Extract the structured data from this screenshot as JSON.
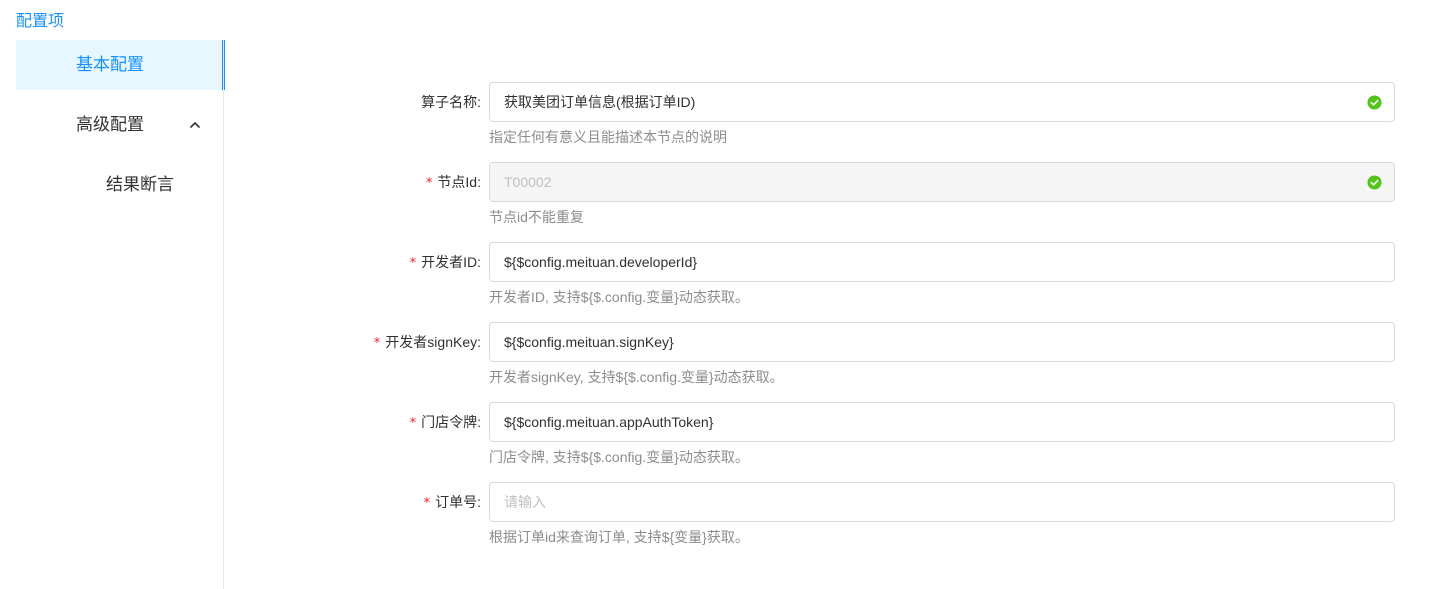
{
  "section_title": "配置项",
  "sidebar": {
    "items": [
      {
        "label": "基本配置"
      },
      {
        "label": "高级配置"
      },
      {
        "label": "结果断言"
      }
    ]
  },
  "form": {
    "rows": [
      {
        "label": "算子名称:",
        "value": "获取美团订单信息(根据订单ID)",
        "placeholder": "",
        "help": "指定任何有意义且能描述本节点的说明"
      },
      {
        "label": "节点Id:",
        "value": "T00002",
        "placeholder": "",
        "help": "节点id不能重复"
      },
      {
        "label": "开发者ID:",
        "value": "${$config.meituan.developerId}",
        "placeholder": "",
        "help": "开发者ID, 支持${$.config.变量}动态获取。"
      },
      {
        "label": "开发者signKey:",
        "value": "${$config.meituan.signKey}",
        "placeholder": "",
        "help": "开发者signKey, 支持${$.config.变量}动态获取。"
      },
      {
        "label": "门店令牌:",
        "value": "${$config.meituan.appAuthToken}",
        "placeholder": "",
        "help": "门店令牌, 支持${$.config.变量}动态获取。"
      },
      {
        "label": "订单号:",
        "value": "",
        "placeholder": "请输入",
        "help": "根据订单id来查询订单, 支持${变量}获取。"
      }
    ]
  },
  "colors": {
    "accent": "#1890ff",
    "success": "#52c41a",
    "required": "#f5222d"
  },
  "icons": {
    "valid": "check-circle-icon",
    "collapse": "chevron-up-icon"
  }
}
